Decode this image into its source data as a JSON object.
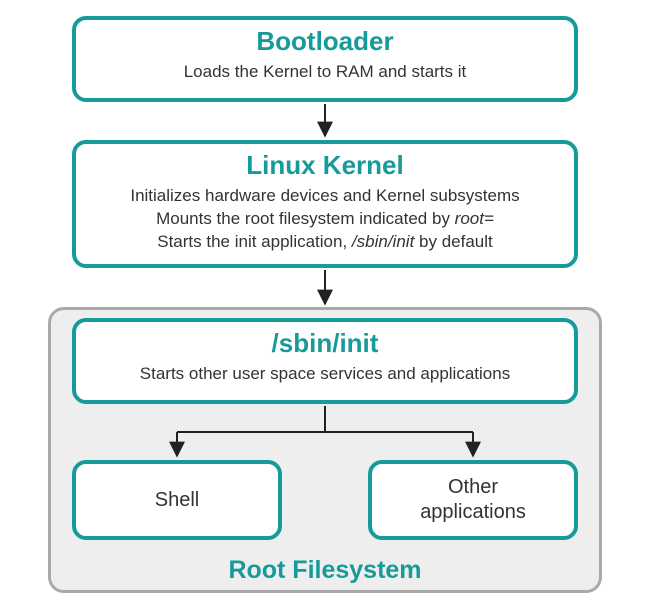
{
  "diagram": {
    "bootloader": {
      "title": "Bootloader",
      "desc": "Loads the Kernel to RAM and starts it"
    },
    "kernel": {
      "title": "Linux Kernel",
      "desc_line1": "Initializes hardware devices and Kernel subsystems",
      "desc_line2_pre": "Mounts the root filesystem indicated by ",
      "desc_line2_em": "root=",
      "desc_line3_pre": "Starts the init application, ",
      "desc_line3_em": "/sbin/init",
      "desc_line3_post": " by default"
    },
    "init": {
      "title": "/sbin/init",
      "desc": "Starts other user space services and applications"
    },
    "shell": {
      "label": "Shell"
    },
    "other": {
      "label_line1": "Other",
      "label_line2": "applications"
    },
    "rootfs": {
      "label": "Root Filesystem"
    }
  },
  "colors": {
    "accent": "#179a9a",
    "container_border": "#a9a9a9",
    "container_bg": "#eeeeee"
  }
}
